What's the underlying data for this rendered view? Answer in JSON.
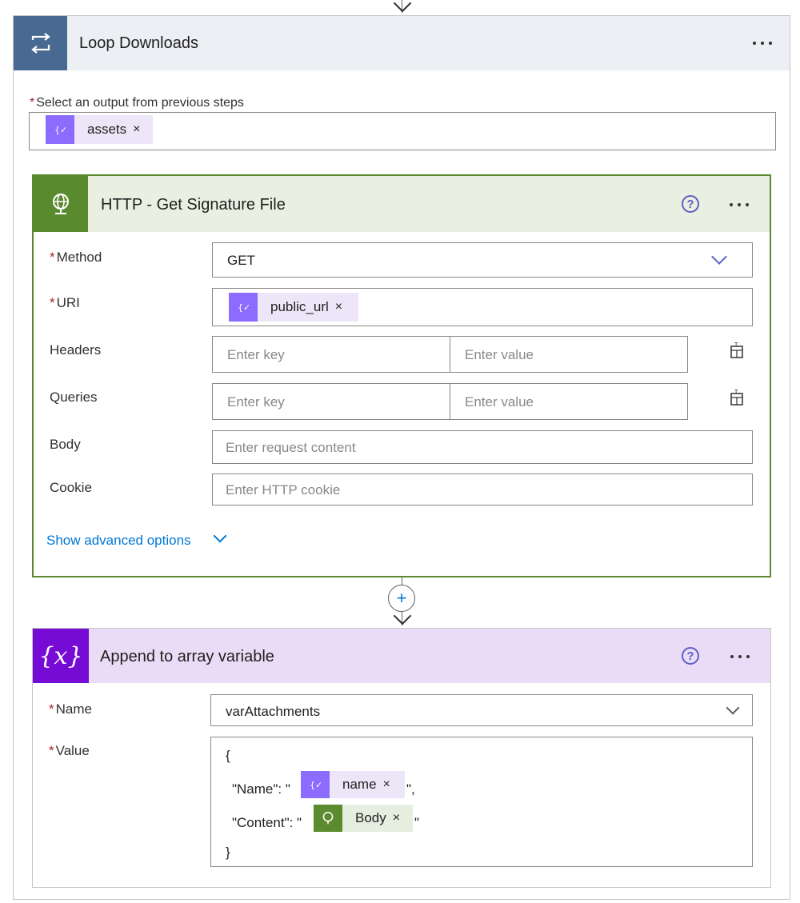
{
  "loop": {
    "title": "Loop Downloads",
    "select_label": "Select an output from previous steps",
    "token_label": "assets",
    "token_close": "×"
  },
  "http": {
    "title": "HTTP - Get Signature File",
    "help": "?",
    "method_label": "Method",
    "method_value": "GET",
    "uri_label": "URI",
    "uri_token": "public_url",
    "uri_token_close": "×",
    "headers_label": "Headers",
    "queries_label": "Queries",
    "key_placeholder": "Enter key",
    "value_placeholder": "Enter value",
    "body_label": "Body",
    "body_placeholder": "Enter request content",
    "cookie_label": "Cookie",
    "cookie_placeholder": "Enter HTTP cookie",
    "advanced_link": "Show advanced options"
  },
  "connector": {
    "plus": "+"
  },
  "append": {
    "title": "Append to array variable",
    "icon_text": "{x}",
    "help": "?",
    "name_label": "Name",
    "name_value": "varAttachments",
    "value_label": "Value",
    "code_open": "{",
    "code_name_key": "\"Name\": \"",
    "code_name_token": "name",
    "code_name_tail": "\",",
    "code_content_key": "\"Content\": \"",
    "code_content_token": "Body",
    "code_content_tail": "\"",
    "code_close": "}",
    "token_close": "×"
  },
  "required_marker": "*",
  "icons": {
    "loop": "loop-arrows-icon",
    "http": "globe-icon",
    "variable": "variable-icon",
    "expression": "expression-icon",
    "help": "help-circle-icon",
    "more": "ellipsis-icon",
    "dropdown": "chevron-down-icon",
    "table_switch": "switch-to-text-icon"
  },
  "colors": {
    "loop_accent": "#486991",
    "http_accent": "#5a8a2e",
    "variable_accent": "#770bd6",
    "token_purple": "#8c6cff",
    "link": "#0078d4",
    "required": "#a4262c"
  }
}
